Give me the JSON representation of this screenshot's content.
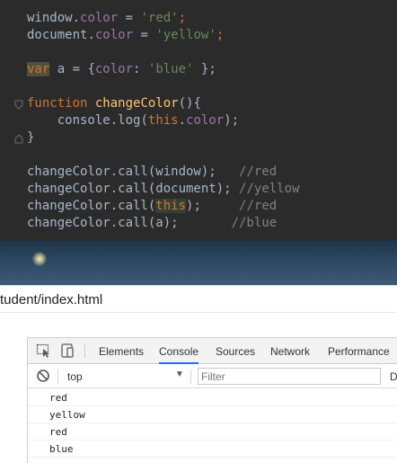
{
  "editor": {
    "lines": [
      [
        {
          "t": "window",
          "c": "ident"
        },
        {
          "t": ".",
          "c": "ident"
        },
        {
          "t": "color",
          "c": "prop"
        },
        {
          "t": " = ",
          "c": "ident"
        },
        {
          "t": "'red'",
          "c": "str"
        },
        {
          "t": ";",
          "c": "kw"
        }
      ],
      [
        {
          "t": "document",
          "c": "ident"
        },
        {
          "t": ".",
          "c": "ident"
        },
        {
          "t": "color",
          "c": "prop"
        },
        {
          "t": " = ",
          "c": "ident"
        },
        {
          "t": "'yellow'",
          "c": "str"
        },
        {
          "t": ";",
          "c": "kw"
        }
      ],
      [],
      [
        {
          "t": "var",
          "c": "kw hl-var"
        },
        {
          "t": " a = {",
          "c": "ident"
        },
        {
          "t": "color",
          "c": "prop"
        },
        {
          "t": ": ",
          "c": "ident"
        },
        {
          "t": "'blue'",
          "c": "str"
        },
        {
          "t": " };",
          "c": "ident"
        }
      ],
      [],
      [
        {
          "t": "function",
          "c": "kw"
        },
        {
          "t": " ",
          "c": "ident"
        },
        {
          "t": "changeColor",
          "c": "fn"
        },
        {
          "t": "(){",
          "c": "ident"
        }
      ],
      [
        {
          "t": "    console.",
          "c": "ident"
        },
        {
          "t": "log",
          "c": "ident"
        },
        {
          "t": "(",
          "c": "ident"
        },
        {
          "t": "this",
          "c": "kw"
        },
        {
          "t": ".",
          "c": "ident"
        },
        {
          "t": "color",
          "c": "prop"
        },
        {
          "t": ");",
          "c": "ident"
        }
      ],
      [
        {
          "t": "}",
          "c": "ident"
        }
      ],
      [],
      [
        {
          "t": "changeColor.call(window);   ",
          "c": "ident"
        },
        {
          "t": "//red",
          "c": "cm"
        }
      ],
      [
        {
          "t": "changeColor.call(document); ",
          "c": "ident"
        },
        {
          "t": "//yellow",
          "c": "cm"
        }
      ],
      [
        {
          "t": "changeColor.call(",
          "c": "ident"
        },
        {
          "t": "this",
          "c": "kw hl-this"
        },
        {
          "t": ");     ",
          "c": "ident"
        },
        {
          "t": "//red",
          "c": "cm"
        }
      ],
      [
        {
          "t": "changeColor.call(a);       ",
          "c": "ident"
        },
        {
          "t": "//blue",
          "c": "cm"
        }
      ]
    ]
  },
  "browser": {
    "address_text": "tudent/index.html"
  },
  "devtools": {
    "tabs": [
      {
        "label": "Elements",
        "active": false
      },
      {
        "label": "Console",
        "active": true
      },
      {
        "label": "Sources",
        "active": false
      },
      {
        "label": "Network",
        "active": false
      },
      {
        "label": "Performance",
        "active": false
      }
    ],
    "context": "top",
    "filter_placeholder": "Filter",
    "levels_label": "De",
    "messages": [
      "red",
      "yellow",
      "red",
      "blue"
    ]
  },
  "colors": {
    "editor_bg": "#2b2b2b",
    "keyword": "#cc7832",
    "string": "#6a8759",
    "property": "#9876aa",
    "function": "#ffc66d",
    "comment": "#808080",
    "active_tab_underline": "#1a73e8"
  },
  "icons": {
    "inspect": "inspect-element-icon",
    "device": "device-toolbar-icon",
    "clear": "clear-console-icon",
    "fold": "code-fold-icon"
  }
}
